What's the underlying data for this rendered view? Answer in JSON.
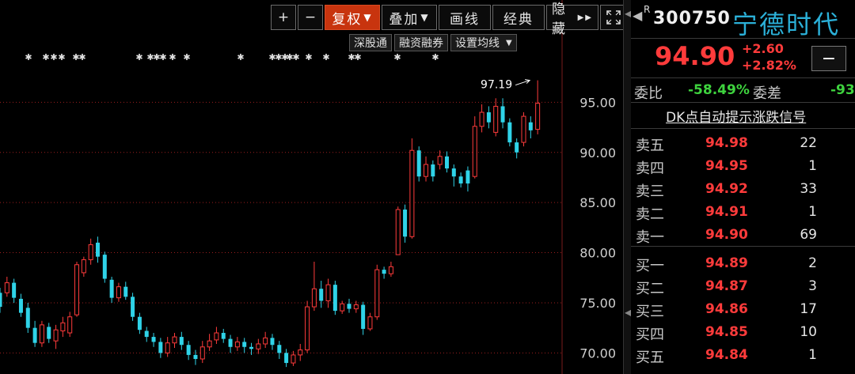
{
  "toolbar": {
    "plus": "+",
    "minus": "−",
    "fuquan": "复权",
    "diejia": "叠加",
    "huaxian": "画线",
    "jingdian": "经典",
    "yincang": "隐藏",
    "expand_icon": "expand-icon"
  },
  "subbar": {
    "shengutong": "深股通",
    "rongzi": "融资融券",
    "set_ma": "设置均线"
  },
  "quote": {
    "code": "300750",
    "r_mark": "R",
    "name": "宁德时代",
    "price": "94.90",
    "change": "+2.60",
    "change_pct": "+2.82%",
    "minus_btn": "−",
    "weibi_label": "委比",
    "weibi_value": "-58.49%",
    "weicha_label": "委差",
    "weicha_value": "-93",
    "dk_link": "DK点自动提示涨跌信号"
  },
  "orderbook": {
    "asks": [
      {
        "label": "卖五",
        "price": "94.98",
        "vol": "22"
      },
      {
        "label": "卖四",
        "price": "94.95",
        "vol": "1"
      },
      {
        "label": "卖三",
        "price": "94.92",
        "vol": "33"
      },
      {
        "label": "卖二",
        "price": "94.91",
        "vol": "1"
      },
      {
        "label": "卖一",
        "price": "94.90",
        "vol": "69"
      }
    ],
    "bids": [
      {
        "label": "买一",
        "price": "94.89",
        "vol": "2"
      },
      {
        "label": "买二",
        "price": "94.87",
        "vol": "3"
      },
      {
        "label": "买三",
        "price": "94.86",
        "vol": "17"
      },
      {
        "label": "买四",
        "price": "94.85",
        "vol": "10"
      },
      {
        "label": "买五",
        "price": "94.84",
        "vol": "1"
      }
    ]
  },
  "colors": {
    "up": "#ff3b3b",
    "down": "#2fd3e8",
    "grid": "#9a1e1e",
    "axis_text": "#cfcfcf",
    "name": "#2bb0d8",
    "green": "#3ed33e"
  },
  "chart_data": {
    "type": "candlestick",
    "y_ticks": [
      "95.00",
      "90.00",
      "85.00",
      "80.00",
      "75.00",
      "70.00"
    ],
    "ylim": [
      67.9,
      105.2
    ],
    "high_annotation": "97.19",
    "candles": [
      {
        "o": 76.0,
        "c": 74.6,
        "h": 76.5,
        "l": 74.0
      },
      {
        "o": 76.0,
        "c": 77.0,
        "h": 77.6,
        "l": 75.6
      },
      {
        "o": 77.0,
        "c": 75.5,
        "h": 77.4,
        "l": 75.0
      },
      {
        "o": 75.4,
        "c": 74.0,
        "h": 75.9,
        "l": 73.6
      },
      {
        "o": 74.5,
        "c": 72.5,
        "h": 75.0,
        "l": 72.0
      },
      {
        "o": 72.5,
        "c": 71.0,
        "h": 73.2,
        "l": 70.6
      },
      {
        "o": 71.0,
        "c": 72.8,
        "h": 73.2,
        "l": 70.6
      },
      {
        "o": 72.6,
        "c": 71.4,
        "h": 73.0,
        "l": 71.0
      },
      {
        "o": 71.2,
        "c": 72.3,
        "h": 72.8,
        "l": 70.4
      },
      {
        "o": 72.2,
        "c": 73.0,
        "h": 73.6,
        "l": 71.6
      },
      {
        "o": 72.0,
        "c": 73.6,
        "h": 74.1,
        "l": 71.6
      },
      {
        "o": 73.8,
        "c": 78.8,
        "h": 79.1,
        "l": 73.6
      },
      {
        "o": 78.0,
        "c": 79.3,
        "h": 79.6,
        "l": 77.6
      },
      {
        "o": 79.3,
        "c": 80.8,
        "h": 81.4,
        "l": 78.8
      },
      {
        "o": 81.0,
        "c": 79.6,
        "h": 81.6,
        "l": 79.0
      },
      {
        "o": 79.8,
        "c": 77.4,
        "h": 80.1,
        "l": 77.0
      },
      {
        "o": 77.3,
        "c": 75.5,
        "h": 77.6,
        "l": 75.0
      },
      {
        "o": 75.5,
        "c": 76.6,
        "h": 77.0,
        "l": 75.1
      },
      {
        "o": 76.6,
        "c": 75.6,
        "h": 77.1,
        "l": 75.3
      },
      {
        "o": 75.6,
        "c": 73.6,
        "h": 76.0,
        "l": 73.2
      },
      {
        "o": 73.6,
        "c": 72.3,
        "h": 74.0,
        "l": 71.9
      },
      {
        "o": 72.2,
        "c": 71.6,
        "h": 72.6,
        "l": 71.1
      },
      {
        "o": 71.6,
        "c": 71.1,
        "h": 72.0,
        "l": 70.6
      },
      {
        "o": 71.1,
        "c": 70.0,
        "h": 71.5,
        "l": 69.5
      },
      {
        "o": 70.0,
        "c": 71.0,
        "h": 71.6,
        "l": 69.6
      },
      {
        "o": 71.0,
        "c": 71.6,
        "h": 72.0,
        "l": 70.5
      },
      {
        "o": 71.6,
        "c": 70.8,
        "h": 72.1,
        "l": 70.3
      },
      {
        "o": 70.8,
        "c": 69.8,
        "h": 71.2,
        "l": 69.3
      },
      {
        "o": 69.8,
        "c": 69.4,
        "h": 70.3,
        "l": 68.8
      },
      {
        "o": 69.4,
        "c": 70.6,
        "h": 71.2,
        "l": 69.0
      },
      {
        "o": 70.6,
        "c": 71.2,
        "h": 71.9,
        "l": 70.2
      },
      {
        "o": 71.3,
        "c": 72.0,
        "h": 72.6,
        "l": 70.9
      },
      {
        "o": 72.0,
        "c": 71.4,
        "h": 72.4,
        "l": 71.0
      },
      {
        "o": 71.4,
        "c": 70.6,
        "h": 71.8,
        "l": 70.0
      },
      {
        "o": 70.6,
        "c": 71.1,
        "h": 71.6,
        "l": 70.2
      },
      {
        "o": 71.1,
        "c": 70.6,
        "h": 71.5,
        "l": 70.0
      },
      {
        "o": 70.6,
        "c": 70.4,
        "h": 71.0,
        "l": 69.8
      },
      {
        "o": 70.4,
        "c": 70.9,
        "h": 71.4,
        "l": 69.9
      },
      {
        "o": 70.9,
        "c": 71.5,
        "h": 72.1,
        "l": 70.5
      },
      {
        "o": 71.5,
        "c": 70.8,
        "h": 71.9,
        "l": 70.3
      },
      {
        "o": 70.8,
        "c": 70.0,
        "h": 71.2,
        "l": 69.4
      },
      {
        "o": 70.0,
        "c": 69.0,
        "h": 70.4,
        "l": 68.6
      },
      {
        "o": 69.0,
        "c": 69.8,
        "h": 70.2,
        "l": 68.7
      },
      {
        "o": 69.8,
        "c": 70.3,
        "h": 70.9,
        "l": 69.2
      },
      {
        "o": 70.3,
        "c": 74.6,
        "h": 75.2,
        "l": 70.0
      },
      {
        "o": 74.6,
        "c": 76.4,
        "h": 79.1,
        "l": 74.2
      },
      {
        "o": 76.4,
        "c": 75.2,
        "h": 77.2,
        "l": 74.5
      },
      {
        "o": 75.2,
        "c": 76.8,
        "h": 77.4,
        "l": 74.5
      },
      {
        "o": 76.8,
        "c": 74.2,
        "h": 77.2,
        "l": 73.8
      },
      {
        "o": 74.2,
        "c": 74.9,
        "h": 75.2,
        "l": 73.9
      },
      {
        "o": 74.9,
        "c": 74.4,
        "h": 75.4,
        "l": 74.0
      },
      {
        "o": 74.4,
        "c": 74.8,
        "h": 75.2,
        "l": 74.0
      },
      {
        "o": 74.8,
        "c": 72.4,
        "h": 75.1,
        "l": 71.8
      },
      {
        "o": 72.4,
        "c": 73.6,
        "h": 74.0,
        "l": 72.2
      },
      {
        "o": 73.6,
        "c": 78.3,
        "h": 78.8,
        "l": 73.3
      },
      {
        "o": 78.3,
        "c": 77.9,
        "h": 78.6,
        "l": 77.4
      },
      {
        "o": 77.9,
        "c": 78.6,
        "h": 79.1,
        "l": 77.6
      },
      {
        "o": 79.8,
        "c": 84.3,
        "h": 84.6,
        "l": 79.8
      },
      {
        "o": 84.3,
        "c": 81.6,
        "h": 84.8,
        "l": 81.0
      },
      {
        "o": 81.6,
        "c": 90.2,
        "h": 91.4,
        "l": 81.4
      },
      {
        "o": 90.2,
        "c": 87.6,
        "h": 90.6,
        "l": 87.1
      },
      {
        "o": 87.6,
        "c": 88.8,
        "h": 89.6,
        "l": 87.1
      },
      {
        "o": 88.8,
        "c": 87.6,
        "h": 89.2,
        "l": 87.1
      },
      {
        "o": 88.8,
        "c": 89.6,
        "h": 90.2,
        "l": 88.3
      },
      {
        "o": 89.6,
        "c": 88.4,
        "h": 90.1,
        "l": 88.0
      },
      {
        "o": 88.4,
        "c": 87.6,
        "h": 88.8,
        "l": 86.6
      },
      {
        "o": 87.6,
        "c": 86.9,
        "h": 88.0,
        "l": 86.5
      },
      {
        "o": 88.2,
        "c": 86.9,
        "h": 88.6,
        "l": 86.1
      },
      {
        "o": 87.6,
        "c": 92.6,
        "h": 93.6,
        "l": 87.4
      },
      {
        "o": 92.6,
        "c": 94.0,
        "h": 94.8,
        "l": 92.0
      },
      {
        "o": 94.0,
        "c": 93.0,
        "h": 94.6,
        "l": 92.4
      },
      {
        "o": 92.0,
        "c": 94.6,
        "h": 95.4,
        "l": 91.6
      },
      {
        "o": 94.6,
        "c": 93.0,
        "h": 95.4,
        "l": 92.4
      },
      {
        "o": 93.0,
        "c": 91.0,
        "h": 93.4,
        "l": 90.6
      },
      {
        "o": 91.0,
        "c": 90.0,
        "h": 91.4,
        "l": 89.4
      },
      {
        "o": 91.0,
        "c": 93.6,
        "h": 94.0,
        "l": 90.6
      },
      {
        "o": 93.0,
        "c": 92.2,
        "h": 93.6,
        "l": 91.4
      },
      {
        "o": 92.3,
        "c": 94.9,
        "h": 97.19,
        "l": 91.8
      }
    ]
  }
}
